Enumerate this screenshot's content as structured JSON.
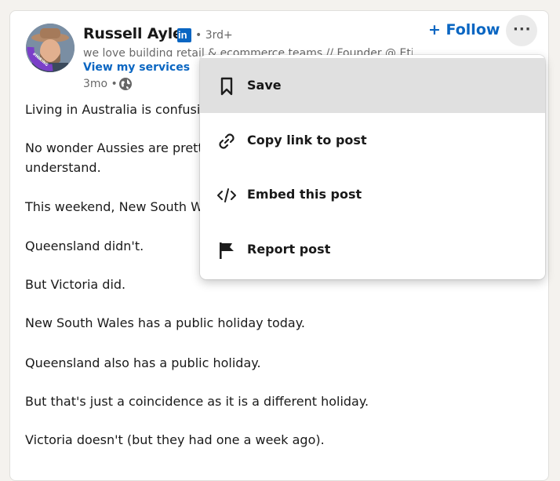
{
  "post": {
    "author": {
      "name": "Russell Ayles",
      "degree": "• 3rd+",
      "headline": "we love building retail & ecommerce teams // Founder @ Etisk",
      "services_link": "View my services",
      "time": "3mo •",
      "avatar_badge": "#HIRING"
    },
    "follow_label": "+ Follow",
    "more_label": "···",
    "paragraphs": [
      "Living in Australia is confusing sometimes.",
      "No wonder Aussies are pretty relaxed — the rules are hard to",
      "understand.",
      "This weekend, New South Wales had a public holiday.",
      "Queensland didn't.",
      "But Victoria did.",
      "New South Wales has a public holiday today.",
      "Queensland also has a public holiday.",
      "But that's just a coincidence as it is a different holiday.",
      "Victoria doesn't (but they had one a week ago)."
    ]
  },
  "menu": {
    "items": [
      {
        "label": "Save",
        "icon": "bookmark-icon"
      },
      {
        "label": "Copy link to post",
        "icon": "link-icon"
      },
      {
        "label": "Embed this post",
        "icon": "code-icon"
      },
      {
        "label": "Report post",
        "icon": "flag-icon"
      }
    ]
  },
  "colors": {
    "brand": "#0a66c2",
    "menu_hover": "#e0e0e0",
    "page_bg": "#f4f2ee"
  }
}
